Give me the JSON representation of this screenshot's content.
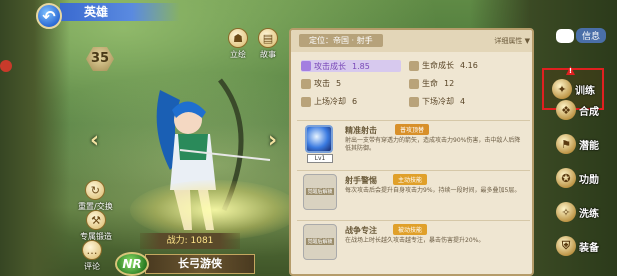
{
  "header": {
    "title": "英雄",
    "back_icon": "back-arrow-icon"
  },
  "hero": {
    "level": "35",
    "power": "战力: 1081",
    "rarity": "NR",
    "name": "长弓游侠"
  },
  "left_buttons": {
    "stand": "立绘",
    "story": "故事",
    "reset": "重置/交换",
    "exclusive": "专属锻造",
    "chat": "评论"
  },
  "panel": {
    "position": "定位：帝国 · 射手",
    "detail_link": "详细属性 ▼",
    "stats": [
      {
        "label": "攻击成长",
        "value": "1.85",
        "highlight": true
      },
      {
        "label": "生命成长",
        "value": "4.16",
        "highlight": false
      },
      {
        "label": "攻击",
        "value": "5",
        "highlight": false
      },
      {
        "label": "生命",
        "value": "12",
        "highlight": false
      },
      {
        "label": "上场冷却",
        "value": "6",
        "highlight": false
      },
      {
        "label": "下场冷却",
        "value": "4",
        "highlight": false
      }
    ],
    "skills": [
      {
        "name": "精准射击",
        "tag": "普攻顶替",
        "level": "Lv1",
        "desc": "射出一支带有穿透力的箭矢，造成攻击力90%伤害，击中敌人后降低其防御。"
      },
      {
        "name": "射手警惕",
        "tag": "主动技能",
        "lock_text": [
          "觉醒后解锁"
        ],
        "desc": "每次攻击后会提升自身攻击力9%，持续一段时间，最多叠加5层。"
      },
      {
        "name": "战争专注",
        "tag": "被动技能",
        "lock_text": [
          "觉醒后解锁"
        ],
        "desc": "在战场上时长越久攻击越专注，暴击伤害提升20%。"
      }
    ]
  },
  "menu": {
    "info_label": "信息",
    "items": [
      {
        "label": "训练",
        "icon": "training-icon",
        "active": true,
        "alert": "!"
      },
      {
        "label": "合成",
        "icon": "compose-icon"
      },
      {
        "label": "潜能",
        "icon": "potential-icon"
      },
      {
        "label": "功勋",
        "icon": "merit-icon"
      },
      {
        "label": "洗练",
        "icon": "refine-icon"
      },
      {
        "label": "装备",
        "icon": "equipment-icon"
      }
    ]
  },
  "colors": {
    "accent_blue": "#2d6bd4",
    "panel_bg": "#efe6d2",
    "highlight_purple": "#a37ee0",
    "alert_red": "#e02020"
  }
}
